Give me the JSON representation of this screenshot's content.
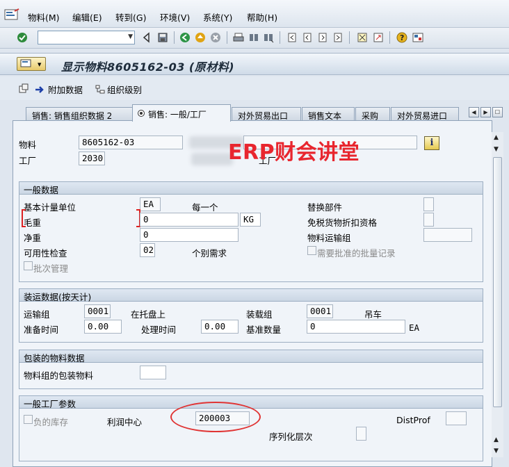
{
  "menu": {
    "items": [
      "物料(M)",
      "编辑(E)",
      "转到(G)",
      "环境(V)",
      "系统(Y)",
      "帮助(H)"
    ]
  },
  "toolbar": {
    "command_field_value": "",
    "icons": [
      "enter-icon",
      "back-icon",
      "save-icon",
      "back-nav-icon",
      "exit-icon",
      "cancel-icon",
      "print-icon",
      "find-icon",
      "find-next-icon",
      "first-page-icon",
      "prev-page-icon",
      "next-page-icon",
      "last-page-icon",
      "new-session-icon",
      "shortcut-icon",
      "help-icon",
      "layout-icon"
    ]
  },
  "title": {
    "text": "显示物料8605162-03 (原材料)"
  },
  "app_toolbar": {
    "additional_data": "附加数据",
    "org_levels": "组织级别"
  },
  "tabs": [
    {
      "label": "销售: 销售组织数据 2",
      "active": false
    },
    {
      "label": "销售: 一般/工厂",
      "active": true
    },
    {
      "label": "对外贸易出口",
      "active": false
    },
    {
      "label": "销售文本",
      "active": false
    },
    {
      "label": "采购",
      "active": false
    },
    {
      "label": "对外贸易进口",
      "active": false
    }
  ],
  "header": {
    "material_label": "物料",
    "material_value": "8605162-03",
    "plant_label": "工厂",
    "plant_value": "2030",
    "plant_label_2": "工厂"
  },
  "watermark": "ERP财会讲堂",
  "general_data": {
    "title": "一般数据",
    "base_uom_label": "基本计量单位",
    "base_uom_value": "EA",
    "base_uom_text": "每一个",
    "replacement_part_label": "替换部件",
    "gross_weight_label": "毛重",
    "gross_weight_value": "0",
    "weight_unit_value": "KG",
    "duty_free_label": "免税货物折扣资格",
    "net_weight_label": "净重",
    "net_weight_value": "0",
    "transport_group_label": "物料运输组",
    "availability_check_label": "可用性检查",
    "availability_check_value": "02",
    "availability_check_text": "个别需求",
    "approved_batch_label": "需要批准的批量记录",
    "batch_mgmt_label": "批次管理"
  },
  "shipping_data": {
    "title": "装运数据(按天计)",
    "trans_group_label": "运输组",
    "trans_group_value": "0001",
    "trans_group_text": "在托盘上",
    "loading_group_label": "装载组",
    "loading_group_value": "0001",
    "loading_group_text": "吊车",
    "setup_time_label": "准备时间",
    "setup_time_value": "0.00",
    "processing_time_label": "处理时间",
    "processing_time_value": "0.00",
    "base_qty_label": "基准数量",
    "base_qty_value": "0",
    "base_qty_unit": "EA"
  },
  "packaging": {
    "title": "包装的物料数据",
    "matgroup_label": "物料组的包装物料"
  },
  "general_plant": {
    "title": "一般工厂参数",
    "negative_stock_label": "负的库存",
    "profit_center_label": "利润中心",
    "profit_center_value": "200003",
    "distprof_label": "DistProf",
    "serial_level_label": "序列化层次"
  }
}
